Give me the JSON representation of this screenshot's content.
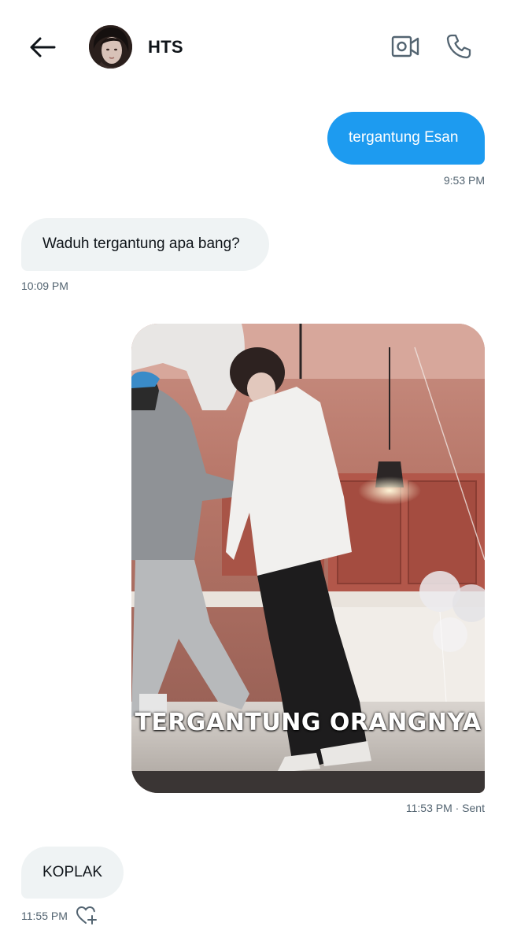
{
  "header": {
    "contact_name": "HTS",
    "back_icon": "arrow-left-icon",
    "video_icon": "video-camera-icon",
    "call_icon": "phone-icon"
  },
  "messages": [
    {
      "direction": "sent",
      "text": "tergantung Esan",
      "meta": "9:53 PM"
    },
    {
      "direction": "received",
      "text": "Waduh tergantung apa bang?",
      "meta": "10:09 PM"
    },
    {
      "direction": "sent",
      "type": "image",
      "caption": "TERGANTUNG ORANGNYA",
      "meta": "11:53 PM · Sent"
    },
    {
      "direction": "received",
      "text": "KOPLAK",
      "meta": "11:55 PM",
      "reaction_icon": "heart-add-icon"
    }
  ],
  "colors": {
    "sent_bubble": "#1d9bf0",
    "received_bubble": "#eff3f4",
    "meta_text": "#536471",
    "icon_gray": "#536471"
  }
}
